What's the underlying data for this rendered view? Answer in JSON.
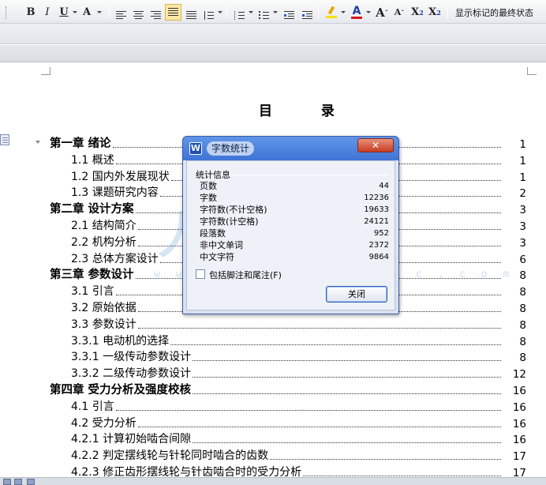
{
  "toolbar": {
    "bold": "B",
    "italic": "I",
    "underline": "U",
    "font_color": "A",
    "grow_font": "A",
    "shrink_font": "A",
    "superscript": "X",
    "superscript_mark": "2",
    "subscript": "X",
    "subscript_mark": "2",
    "show_markup_label": "显示标记的最终状态",
    "highlight_color": "#f5e000",
    "text_color": "#d11a1a"
  },
  "document": {
    "title": "目  录",
    "toc": [
      {
        "level": 1,
        "text": "第一章    绪论",
        "page": "1"
      },
      {
        "level": 2,
        "text": "1.1 概述",
        "page": "1"
      },
      {
        "level": 2,
        "text": "1.2 国内外发展现状",
        "page": "1"
      },
      {
        "level": 2,
        "text": "1.3 课题研究内容",
        "page": "2"
      },
      {
        "level": 1,
        "text": "第二章    设计方案",
        "page": "3"
      },
      {
        "level": 2,
        "text": "2.1 结构简介",
        "page": "3"
      },
      {
        "level": 2,
        "text": "2.2 机构分析",
        "page": "3"
      },
      {
        "level": 2,
        "text": "2.3 总体方案设计",
        "page": "6"
      },
      {
        "level": 1,
        "text": "第三章    参数设计",
        "page": "8"
      },
      {
        "level": 2,
        "text": "3.1 引言",
        "page": "8"
      },
      {
        "level": 2,
        "text": "3.2 原始依据",
        "page": "8"
      },
      {
        "level": 2,
        "text": "3.3 参数设计",
        "page": "8"
      },
      {
        "level": 2,
        "text": "3.3.1 电动机的选择",
        "page": "8"
      },
      {
        "level": 2,
        "text": "3.3.1 一级传动参数设计",
        "page": "8"
      },
      {
        "level": 2,
        "text": "3.3.2 二级传动参数设计",
        "page": "12"
      },
      {
        "level": 1,
        "text": "第四章    受力分析及强度校核",
        "page": "16"
      },
      {
        "level": 2,
        "text": "4.1 引言",
        "page": "16"
      },
      {
        "level": 2,
        "text": "4.2 受力分析",
        "page": "16"
      },
      {
        "level": 2,
        "text": "4.2.1 计算初始啮合间隙",
        "page": "16"
      },
      {
        "level": 2,
        "text": "4.2.2 判定摆线轮与针轮同时啮合的齿数",
        "page": "17"
      },
      {
        "level": 2,
        "text": "4.2.3 修正齿形摆线轮与针齿啮合时的受力分析",
        "page": "17"
      }
    ]
  },
  "watermark": {
    "left": "人",
    "right": "文库",
    "url": "w w w . r e n r e n d o c . c o m"
  },
  "dialog": {
    "app_icon_text": "W",
    "title": "字数统计",
    "close_glyph": "✕",
    "group_label": "统计信息",
    "stats": [
      {
        "label": "页数",
        "value": "44"
      },
      {
        "label": "字数",
        "value": "12236"
      },
      {
        "label": "字符数(不计空格)",
        "value": "19633"
      },
      {
        "label": "字符数(计空格)",
        "value": "24121"
      },
      {
        "label": "段落数",
        "value": "952"
      },
      {
        "label": "非中文单词",
        "value": "2372"
      },
      {
        "label": "中文字符",
        "value": "9864"
      }
    ],
    "checkbox_label": "包括脚注和尾注(F)",
    "checkbox_checked": false,
    "close_button": "关闭"
  }
}
